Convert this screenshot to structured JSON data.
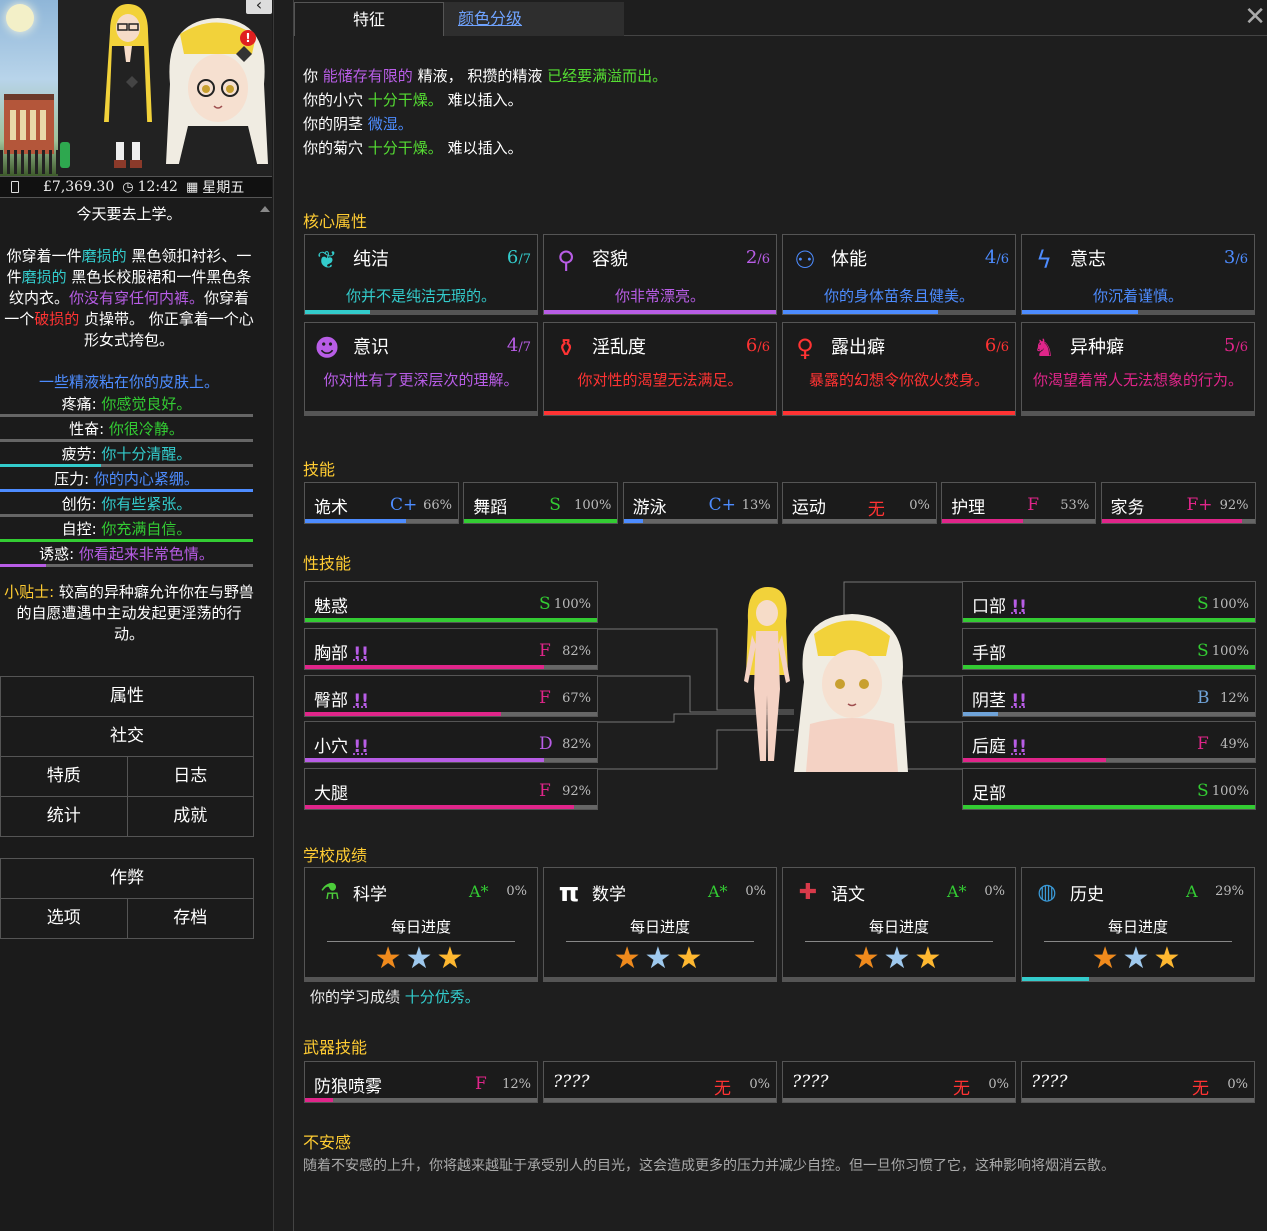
{
  "status": {
    "money": "£7,369.30",
    "time": "12:42",
    "day": "星期五"
  },
  "sidebar": {
    "line_school": "今天要去上学。",
    "clothing": {
      "p1": "你穿着一件",
      "worn1": "磨损的",
      "p2": " 黑色领扣衬衫、一件",
      "worn2": "磨损的",
      "p3": " 黑色长校服裙和一件黑色条纹内衣。",
      "no_under": "你没有穿任何内裤。",
      "p4": "你穿着一个",
      "broken": "破损的",
      "p5": " 贞操带。 你正拿着一个心形女式挎包。"
    },
    "semen_note": "一些精液粘在你的皮肤上。",
    "meters": [
      {
        "label": "疼痛:",
        "text": "你感觉良好。",
        "color": "#33cc33",
        "fill": 0.0,
        "bar": "#33cc33"
      },
      {
        "label": "性奋:",
        "text": "你很冷静。",
        "color": "#33cc33",
        "fill": 0.0,
        "bar": "#33cc33"
      },
      {
        "label": "疲劳:",
        "text": "你十分清醒。",
        "color": "#33cccc",
        "fill": 0.4,
        "bar": "#33cccc"
      },
      {
        "label": "压力:",
        "text": "你的内心紧绷。",
        "color": "#4d8cff",
        "fill": 1.0,
        "bar": "#4d8cff"
      },
      {
        "label": "创伤:",
        "text": "你有些紧张。",
        "color": "#33cccc",
        "fill": 0.0,
        "bar": "#33cccc"
      },
      {
        "label": "自控:",
        "text": "你充满自信。",
        "color": "#33cc33",
        "fill": 1.0,
        "bar": "#33cc33"
      },
      {
        "label": "诱惑:",
        "text": "你看起来非常色情。",
        "color": "#b85de6",
        "fill": 0.18,
        "bar": "#b85de6"
      }
    ],
    "tip_label": "小贴士:",
    "tip_text": " 较高的异种癖允许你在与野兽的自愿遭遇中主动发起更淫荡的行动。",
    "menu": {
      "attributes": "属性",
      "social": "社交",
      "traits": "特质",
      "journal": "日志",
      "stats": "统计",
      "achievements": "成就",
      "cheats": "作弊",
      "options": "选项",
      "saves": "存档"
    }
  },
  "tabs": {
    "traits": "特征",
    "colors": "颜色分级"
  },
  "intro": {
    "l1a": "你 ",
    "l1b": "能储存有限的",
    "l1c": " 精液， 积攒的精液 ",
    "l1d": "已经要满溢而出。",
    "l2a": "你的小穴 ",
    "l2b": "十分干燥。",
    "l2c": " 难以插入。",
    "l3a": "你的阴茎 ",
    "l3b": "微湿。",
    "l4a": "你的菊穴 ",
    "l4b": "十分干燥。",
    "l4c": " 难以插入。"
  },
  "sections": {
    "core": "核心属性",
    "skills": "技能",
    "sex_skills": "性技能",
    "school": "学校成绩",
    "weapons": "武器技能",
    "insecurity": "不安感"
  },
  "core_attributes": [
    {
      "name": "纯洁",
      "level": "6",
      "max": "/7",
      "desc": "你并不是纯洁无瑕的。",
      "color": "#33cccc",
      "fill": 0.28,
      "icon": "halo-icon",
      "glyph": "❦"
    },
    {
      "name": "容貌",
      "level": "2",
      "max": "/6",
      "desc": "你非常漂亮。",
      "color": "#b85de6",
      "fill": 1.0,
      "icon": "mirror-icon",
      "glyph": "⚲"
    },
    {
      "name": "体能",
      "level": "4",
      "max": "/6",
      "desc": "你的身体苗条且健美。",
      "color": "#4d8cff",
      "fill": 0.67,
      "icon": "dumbbell-icon",
      "glyph": "⚇"
    },
    {
      "name": "意志",
      "level": "3",
      "max": "/6",
      "desc": "你沉着谨慎。",
      "color": "#4d8cff",
      "fill": 0.5,
      "icon": "lightning-icon",
      "glyph": "ϟ"
    },
    {
      "name": "意识",
      "level": "4",
      "max": "/7",
      "desc": "你对性有了更深层次的理解。",
      "color": "#b85de6",
      "fill": 0.0,
      "icon": "head-icon",
      "glyph": "☻"
    },
    {
      "name": "淫乱度",
      "level": "6",
      "max": "/6",
      "desc": "你对性的渴望无法满足。",
      "color": "#ff3333",
      "fill": 1.0,
      "icon": "potion-icon",
      "glyph": "⚱"
    },
    {
      "name": "露出癖",
      "level": "6",
      "max": "/6",
      "desc": "暴露的幻想令你欲火焚身。",
      "color": "#ff3333",
      "fill": 1.0,
      "icon": "figure-icon",
      "glyph": "♀"
    },
    {
      "name": "异种癖",
      "level": "5",
      "max": "/6",
      "desc": "你渴望着常人无法想象的行为。",
      "color": "#e0258a",
      "fill": 0.0,
      "icon": "beast-icon",
      "glyph": "♞"
    }
  ],
  "skills": [
    {
      "name": "诡术",
      "grade": "C+",
      "pct": "66%",
      "color": "#4d8cff",
      "fill": 0.66
    },
    {
      "name": "舞蹈",
      "grade": "S",
      "pct": "100%",
      "color": "#33cc33",
      "fill": 1.0
    },
    {
      "name": "游泳",
      "grade": "C+",
      "pct": "13%",
      "color": "#4d8cff",
      "fill": 0.13
    },
    {
      "name": "运动",
      "grade": "无",
      "pct": "0%",
      "color": "#ff3333",
      "fill": 0.0
    },
    {
      "name": "护理",
      "grade": "F",
      "pct": "53%",
      "color": "#e0258a",
      "fill": 0.53
    },
    {
      "name": "家务",
      "grade": "F+",
      "pct": "92%",
      "color": "#e0258a",
      "fill": 0.92
    }
  ],
  "sex_skills_left": [
    {
      "name": "魅惑",
      "warn": "",
      "grade": "S",
      "pct": "100%",
      "color": "#33cc33",
      "fill": 1.0
    },
    {
      "name": "胸部",
      "warn": "!!",
      "grade": "F",
      "pct": "82%",
      "color": "#e0258a",
      "fill": 0.82
    },
    {
      "name": "臀部",
      "warn": "!!",
      "grade": "F",
      "pct": "67%",
      "color": "#e0258a",
      "fill": 0.67
    },
    {
      "name": "小穴",
      "warn": "!!",
      "grade": "D",
      "pct": "82%",
      "color": "#b85de6",
      "fill": 0.82
    },
    {
      "name": "大腿",
      "warn": "",
      "grade": "F",
      "pct": "92%",
      "color": "#e0258a",
      "fill": 0.92
    }
  ],
  "sex_skills_right": [
    {
      "name": "口部",
      "warn": "!!",
      "grade": "S",
      "pct": "100%",
      "color": "#33cc33",
      "fill": 1.0
    },
    {
      "name": "手部",
      "warn": "",
      "grade": "S",
      "pct": "100%",
      "color": "#33cc33",
      "fill": 1.0
    },
    {
      "name": "阴茎",
      "warn": "!!",
      "grade": "B",
      "pct": "12%",
      "color": "#6fa3d8",
      "fill": 0.12
    },
    {
      "name": "后庭",
      "warn": "!!",
      "grade": "F",
      "pct": "49%",
      "color": "#e0258a",
      "fill": 0.49
    },
    {
      "name": "足部",
      "warn": "",
      "grade": "S",
      "pct": "100%",
      "color": "#33cc33",
      "fill": 1.0
    }
  ],
  "school": [
    {
      "name": "科学",
      "grade": "A*",
      "pct": "0%",
      "daily": "每日进度",
      "icon": "flask-icon",
      "glyph": "⚗",
      "fill": 0.0
    },
    {
      "name": "数学",
      "grade": "A*",
      "pct": "0%",
      "daily": "每日进度",
      "icon": "pi-icon",
      "glyph": "π",
      "fill": 0.0
    },
    {
      "name": "语文",
      "grade": "A*",
      "pct": "0%",
      "daily": "每日进度",
      "icon": "flag-icon",
      "glyph": "✚",
      "fill": 0.0
    },
    {
      "name": "历史",
      "grade": "A",
      "pct": "29%",
      "daily": "每日进度",
      "icon": "globe-icon",
      "glyph": "◍",
      "fill": 0.29
    }
  ],
  "school_summary": {
    "a": "你的学习成绩 ",
    "b": "十分优秀。"
  },
  "weapons": [
    {
      "name": "防狼喷雾",
      "grade": "F",
      "pct": "12%",
      "color": "#e0258a",
      "fill": 0.12
    },
    {
      "name": "????",
      "grade": "无",
      "pct": "0%",
      "color": "#ff3333",
      "fill": 0.0
    },
    {
      "name": "????",
      "grade": "无",
      "pct": "0%",
      "color": "#ff3333",
      "fill": 0.0
    },
    {
      "name": "????",
      "grade": "无",
      "pct": "0%",
      "color": "#ff3333",
      "fill": 0.0
    }
  ],
  "insecurity_text": "随着不安感的上升，你将越来越耻于承受别人的目光，这会造成更多的压力并减少自控。但一旦你习惯了它，这种影响将烟消云散。"
}
